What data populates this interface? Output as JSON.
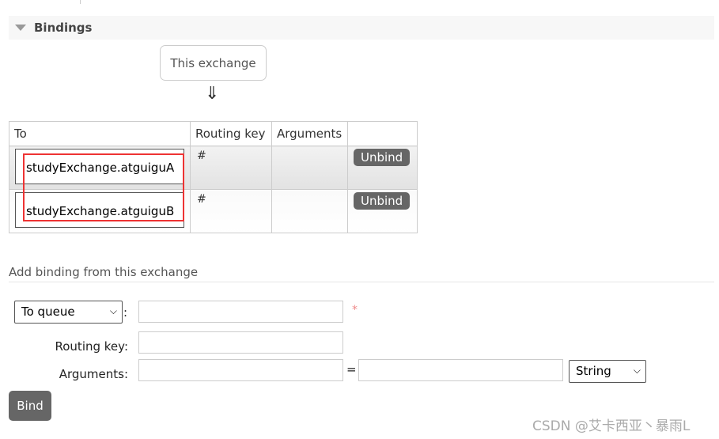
{
  "section": {
    "title": "Bindings",
    "toggle_icon": "triangle-down-icon"
  },
  "source": {
    "label": "This exchange",
    "arrow": "⇓"
  },
  "bindings_table": {
    "headers": [
      "To",
      "Routing key",
      "Arguments",
      ""
    ],
    "rows": [
      {
        "to": "studyExchange.atguiguA",
        "routing_key": "#",
        "arguments": "",
        "action": "Unbind"
      },
      {
        "to": "studyExchange.atguiguB",
        "routing_key": "#",
        "arguments": "",
        "action": "Unbind"
      }
    ]
  },
  "add_binding": {
    "title": "Add binding from this exchange",
    "destination_type": "To queue",
    "colon": ":",
    "required_mark": "*",
    "routing_key_label": "Routing key:",
    "arguments_label": "Arguments:",
    "equals": "=",
    "arg_type": "String",
    "bind_label": "Bind"
  },
  "watermark": "CSDN @艾卡西亚丶暴雨L",
  "colors": {
    "button": "#666666",
    "highlight": "#ee3333",
    "required": "#e88"
  }
}
